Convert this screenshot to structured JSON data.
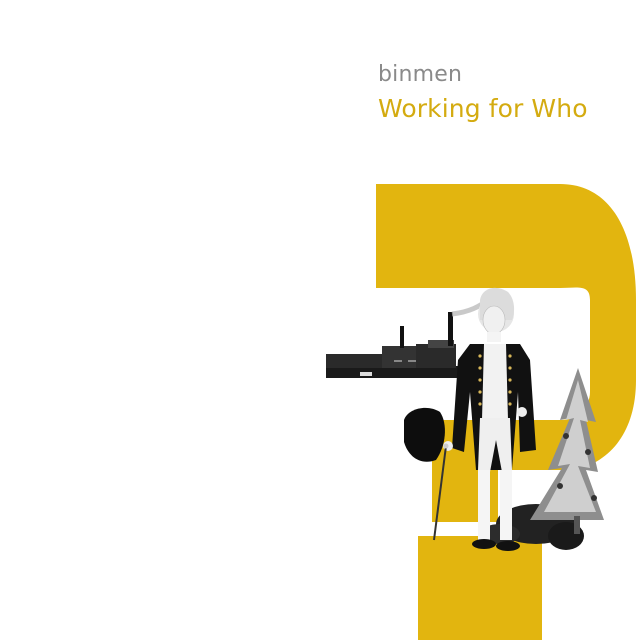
{
  "album": {
    "artist": "binmen",
    "title": "Working for Who"
  },
  "colors": {
    "background": "#ffffff",
    "accent": "#e2b50f",
    "artist_text": "#8a8a8a",
    "title_text": "#d4ab10"
  },
  "artwork": {
    "question_mark": "question-mark-shape",
    "collage": [
      "factory-icon",
      "gentleman-figure-icon",
      "tricorn-hat-icon",
      "walking-cane-icon",
      "dog-icon",
      "pine-tree-icon"
    ]
  }
}
